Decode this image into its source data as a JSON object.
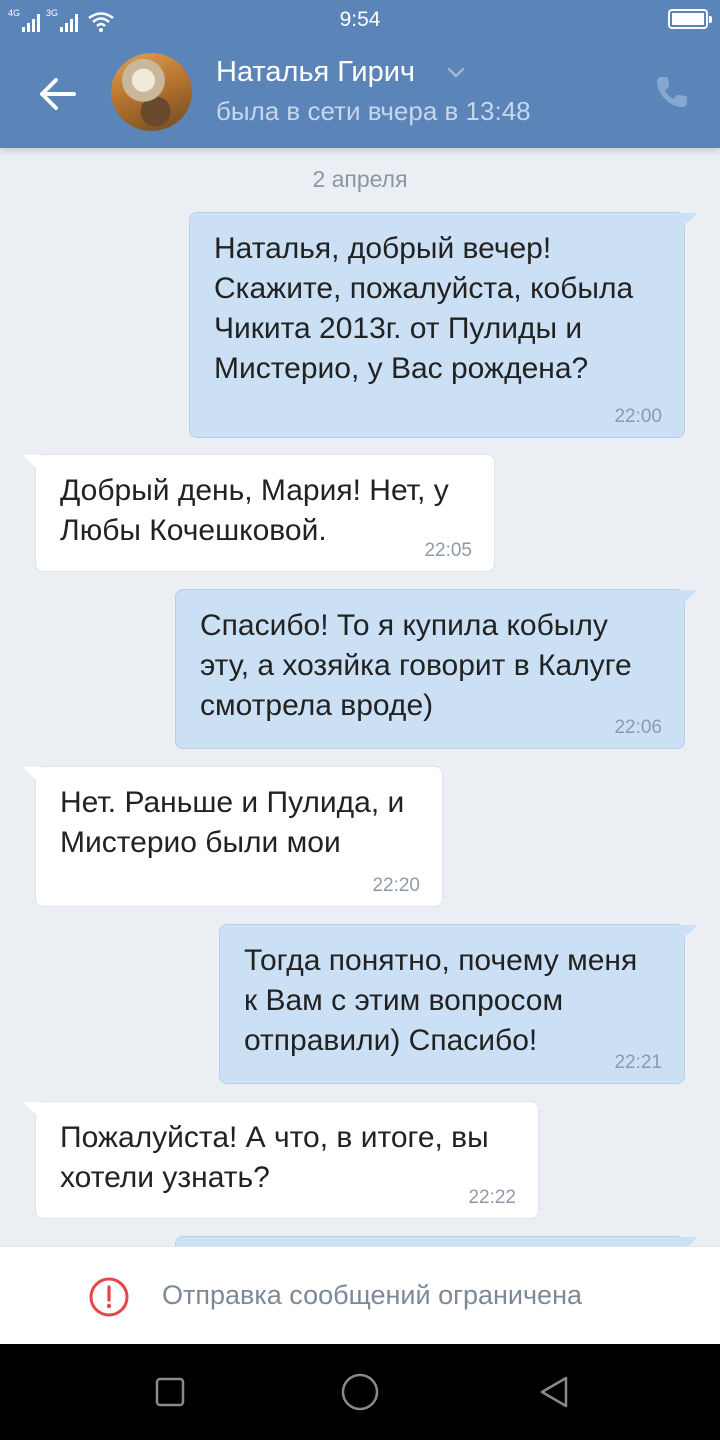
{
  "status_bar": {
    "time": "9:54",
    "network_1": "4G",
    "network_2": "3G",
    "battery_level": 1.0
  },
  "header": {
    "contact_name": "Наталья Гирич",
    "last_seen": "была в сети вчера в 13:48",
    "back_icon": "arrow-left-icon",
    "call_icon": "phone-icon",
    "chevron_icon": "chevron-down-icon"
  },
  "chat": {
    "date_separator": "2 апреля",
    "messages": [
      {
        "direction": "out",
        "lines": [
          "Наталья, добрый вечер!",
          "Скажите, пожалуйста, кобыла",
          "Чикита 2013г. от Пулиды и",
          "Мистерио, у Вас рождена?"
        ],
        "time": "22:00"
      },
      {
        "direction": "in",
        "lines": [
          "Добрый день, Мария! Нет, у",
          "Любы Кочешковой."
        ],
        "time": "22:05"
      },
      {
        "direction": "out",
        "lines": [
          "Спасибо! То я купила кобылу",
          "эту, а хозяйка говорит в Калуге",
          "смотрела вроде)"
        ],
        "time": "22:06"
      },
      {
        "direction": "in",
        "lines": [
          "Нет. Раньше и Пулида, и",
          "Мистерио были мои"
        ],
        "time": "22:20"
      },
      {
        "direction": "out",
        "lines": [
          "Тогда понятно, почему меня",
          "к Вам с этим вопросом",
          "отправили) Спасибо!"
        ],
        "time": "22:21"
      },
      {
        "direction": "in",
        "lines": [
          "Пожалуйста! А что, в итоге, вы",
          "хотели узнать?"
        ],
        "time": "22:22"
      }
    ]
  },
  "footer": {
    "restricted_text": "Отправка сообщений ограничена",
    "warning_icon": "exclamation-circle-icon"
  },
  "colors": {
    "header_bg": "#5b84b9",
    "out_bubble": "#cce0f5",
    "in_bubble": "#ffffff",
    "chat_bg": "#ebeff4",
    "warning": "#e64646"
  },
  "nav": {
    "recents_icon": "square-icon",
    "home_icon": "circle-icon",
    "back_icon": "triangle-back-icon"
  }
}
